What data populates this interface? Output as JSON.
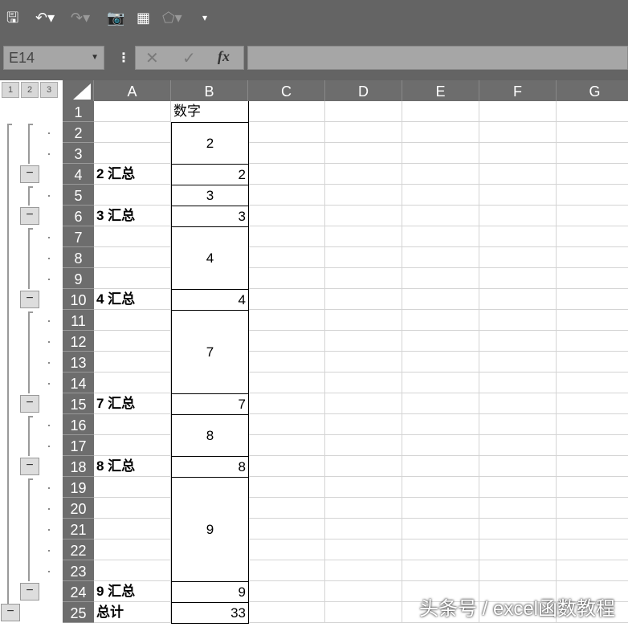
{
  "toolbar": {
    "items": [
      "save-icon",
      "undo-icon",
      "redo-icon",
      "camera-icon",
      "form-icon",
      "shape-icon",
      "customize-icon"
    ]
  },
  "name_box": "E14",
  "formula_buttons": {
    "cancel": "✕",
    "enter": "✓",
    "fx": "fx"
  },
  "outline_levels": [
    "1",
    "2",
    "3"
  ],
  "columns": [
    "A",
    "B",
    "C",
    "D",
    "E",
    "F",
    "G"
  ],
  "rows": [
    {
      "n": "1",
      "a": "",
      "b": "数字"
    },
    {
      "n": "2",
      "a": "",
      "b": ""
    },
    {
      "n": "3",
      "a": "",
      "b": ""
    },
    {
      "n": "4",
      "a": "2 汇总",
      "b": "2"
    },
    {
      "n": "5",
      "a": "",
      "b": "3"
    },
    {
      "n": "6",
      "a": "3 汇总",
      "b": "3"
    },
    {
      "n": "7",
      "a": "",
      "b": ""
    },
    {
      "n": "8",
      "a": "",
      "b": ""
    },
    {
      "n": "9",
      "a": "",
      "b": ""
    },
    {
      "n": "10",
      "a": "4 汇总",
      "b": "4"
    },
    {
      "n": "11",
      "a": "",
      "b": ""
    },
    {
      "n": "12",
      "a": "",
      "b": ""
    },
    {
      "n": "13",
      "a": "",
      "b": ""
    },
    {
      "n": "14",
      "a": "",
      "b": ""
    },
    {
      "n": "15",
      "a": "7 汇总",
      "b": "7"
    },
    {
      "n": "16",
      "a": "",
      "b": ""
    },
    {
      "n": "17",
      "a": "",
      "b": ""
    },
    {
      "n": "18",
      "a": "8 汇总",
      "b": "8"
    },
    {
      "n": "19",
      "a": "",
      "b": ""
    },
    {
      "n": "20",
      "a": "",
      "b": ""
    },
    {
      "n": "21",
      "a": "",
      "b": ""
    },
    {
      "n": "22",
      "a": "",
      "b": ""
    },
    {
      "n": "23",
      "a": "",
      "b": ""
    },
    {
      "n": "24",
      "a": "9 汇总",
      "b": "9"
    },
    {
      "n": "25",
      "a": "总计",
      "b": "33"
    }
  ],
  "merged_b": [
    {
      "from": 2,
      "to": 3,
      "value": "2"
    },
    {
      "from": 7,
      "to": 9,
      "value": "4"
    },
    {
      "from": 11,
      "to": 14,
      "value": "7"
    },
    {
      "from": 16,
      "to": 17,
      "value": "8"
    },
    {
      "from": 19,
      "to": 23,
      "value": "9"
    }
  ],
  "groups": [
    {
      "from": 2,
      "to": 3,
      "summary": 4
    },
    {
      "from": 5,
      "to": 5,
      "summary": 6
    },
    {
      "from": 7,
      "to": 9,
      "summary": 10
    },
    {
      "from": 11,
      "to": 14,
      "summary": 15
    },
    {
      "from": 16,
      "to": 17,
      "summary": 18
    },
    {
      "from": 19,
      "to": 23,
      "summary": 24
    }
  ],
  "watermark": "头条号 / excel函数教程"
}
